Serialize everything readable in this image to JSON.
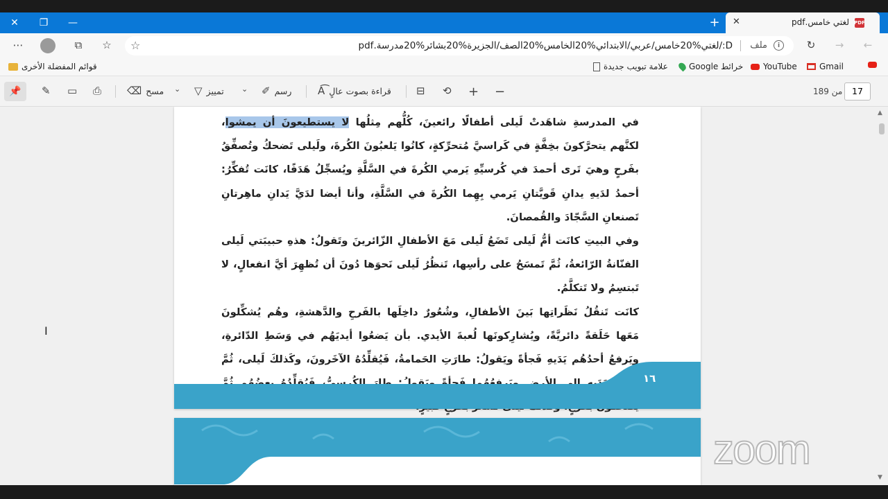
{
  "browser": {
    "tab_title": "لغتي خامس.pdf",
    "url_label": "ملف",
    "url": "D:/لغتي%20خامس/عربي/الابتدائي%20الخامس%20الصف/الجزيرة%20بشائر%20مدرسة.pdf"
  },
  "favorites": {
    "items": [
      {
        "label": "Gmail",
        "icon": "gmail-icon"
      },
      {
        "label": "YouTube",
        "icon": "youtube-icon"
      },
      {
        "label": "خرائط Google",
        "icon": "maps-icon"
      },
      {
        "label": "علامة تبويب جديدة",
        "icon": "document-icon"
      }
    ],
    "other_favorites": "قوائم المفضلة الأخرى"
  },
  "pdf_toolbar": {
    "page_current": "17",
    "page_total": "من 189",
    "read_aloud": "قراءة بصوت عالٍ",
    "draw": "رسم",
    "highlight": "تمييز",
    "erase": "مسح"
  },
  "document": {
    "paragraphs": [
      {
        "before": "في المدرسةِ شاهَدتْ لَيلى أطفالًا رائعينَ، كُلُّهم مِثلُها ",
        "highlight": "لا يستطيعونَ أن يمشوا",
        "after": "، لكنَّهم يتحرَّكونَ بخِفَّةٍ في كَراسيَّ مُتحرِّكةٍ، كانُوا يَلعبُونَ الكُرةَ، ولَيلى تَضحكُ وتُصفِّقُ بفَرحٍ وهيَ تَرى أحمدَ في كُرسيِّهِ يَرمي الكُرةَ في السَّلَّةِ ويُسجِّلُ هَدَفًا، كانَت تُفكِّرُ: أحمدُ لدَيهِ يدانِ قَويَّتانِ يَرمي بِهِما الكُرةَ في السَّلَّةِ، وأنا أيضا لدَيَّ يَدانِ ماهِرتانِ تَصنعانِ السَّجّادَ والقُمصانَ."
      },
      {
        "text": "وفي البيتِ كانَت أمُّ لَيلى تَضَعُ لَيلى مَعَ الأطفالِ الزّائرينَ وتَقولُ: هذهِ حبيبَتي لَيلى الفنّانةُ الرّائعةُ، ثُمَّ تَمسَحُ على رأسِها، تَنظُرُ لَيلى نَحوَها دُونَ أن تُظهِرَ أيَّ انفعالٍ، لا تَبتسِمُ ولا تَتكلَّمُ."
      },
      {
        "text": "كانَت تَنقُلُ نَظَراتِها بَينَ الأطفالِ، وشُعُورٌ داخِلَها بالفَرحِ والدَّهشةِ، وهُم يُشكِّلونَ مَعَها حَلَقةً دائريَّةً، ويُشارِكونَها لُعبةَ الأيدي. بأن يَضعُوا أيديَهُم في وَسَطِ الدّائرةِ، ويَرفعُ أحدُهُم يَدَيهِ فَجأةً ويَقولُ: طارَتِ الحَمامةُ، فَيُقلِّدُهُ الآخَرونَ، وكَذلكَ لَيلى، ثُمَّ يَعُودُ بِيَدَيهِ إلى الأرضِ ويَرفعُهُما فَجأةً ويَقولُ: طارَ الكُرسيُّ، فَيُقلِّدُهُ بعضُهُم ثُمَّ يَضحكُونَ بفَرحٍ، وكَذلكَ لَيلى تَشعُرُ بفَرحٍ كَبيرٍ."
      }
    ],
    "page_number": "١٦"
  },
  "watermark": "zoom",
  "colors": {
    "browser_blue": "#0a78d7",
    "page_teal": "#3aa3c9"
  }
}
